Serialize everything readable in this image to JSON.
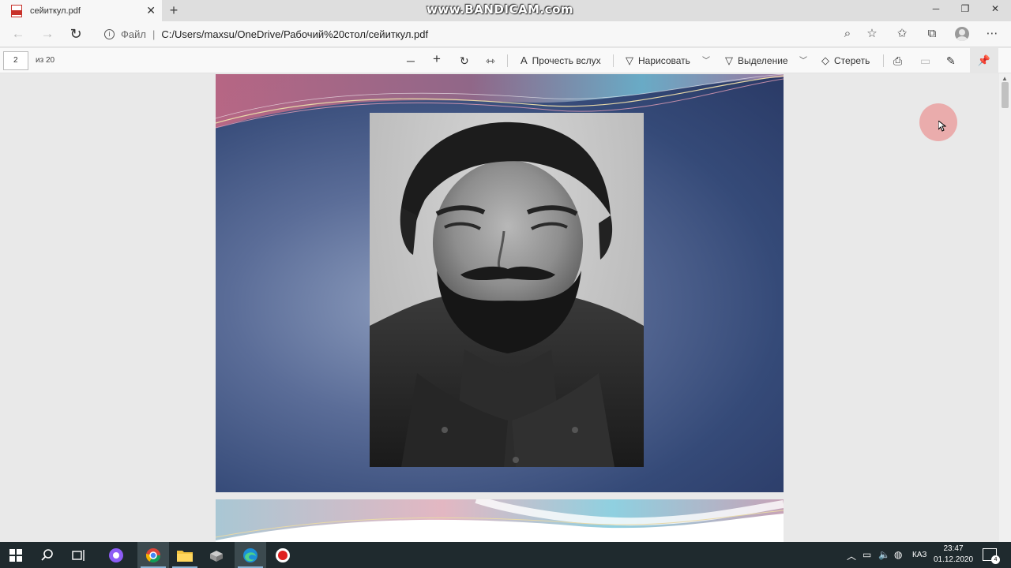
{
  "tab": {
    "title": "сейиткул.pdf",
    "close": "✕",
    "new_tab": "+"
  },
  "watermark": "www.BANDICAM.com",
  "window": {
    "minimize": "─",
    "maximize": "❐",
    "close": "✕"
  },
  "address": {
    "scheme": "Файл",
    "separator": "|",
    "url": "C:/Users/maxsu/OneDrive/Рабочий%20стол/сейиткул.pdf"
  },
  "pdf_toolbar": {
    "page_current": "2",
    "page_total": "из 20",
    "read_aloud": "Прочесть вслух",
    "draw": "Нарисовать",
    "highlight": "Выделение",
    "erase": "Стереть"
  },
  "taskbar": {
    "language": "КАЗ",
    "time": "23:47",
    "date": "01.12.2020",
    "notifications": "4"
  },
  "colors": {
    "slide_bg": "#3a4f7e",
    "taskbar": "#1f2a2e",
    "accent": "#c8312a"
  }
}
